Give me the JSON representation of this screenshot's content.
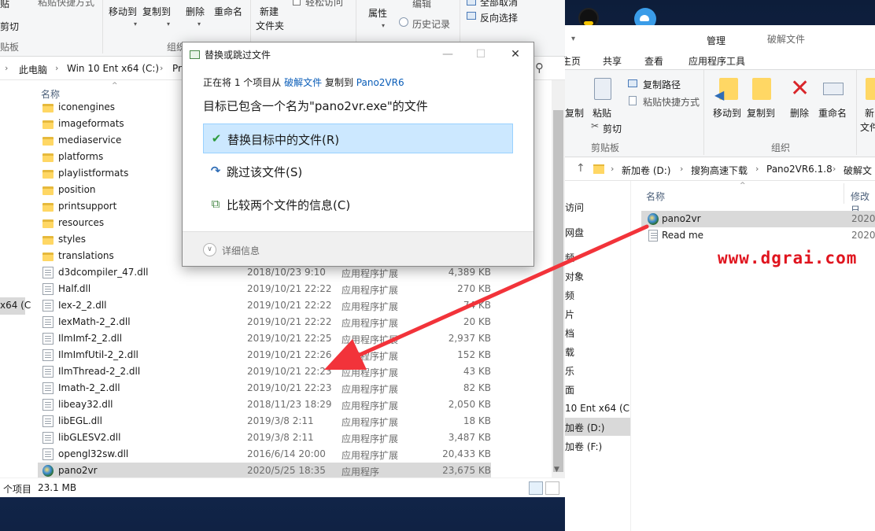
{
  "left_window": {
    "ribbon": {
      "clipboard_partial": "贴",
      "paste_shortcut_partial": "粘贴快捷方式",
      "cut": "剪切",
      "clipboard_group": "贴板",
      "move_to": "移动到",
      "copy_to": "复制到",
      "delete": "删除",
      "rename": "重命名",
      "new_folder_line1": "新建",
      "new_folder_line2": "文件夹",
      "easy_access_partial": "轻松访问",
      "organize_group": "组织",
      "new_group_partial": "新",
      "properties": "属性",
      "edit_partial": "编辑",
      "history": "历史记录",
      "select_none_partial": "全部取消",
      "invert_selection": "反向选择"
    },
    "address": {
      "parts": [
        "此电脑",
        "Win 10 Ent x64 (C:)",
        "Pr"
      ]
    },
    "column_name": "名称",
    "nav_selected_partial": "x64 (C",
    "files": [
      {
        "name": "iconengines",
        "date": "",
        "type": "",
        "size": "",
        "kind": "folder"
      },
      {
        "name": "imageformats",
        "date": "",
        "type": "",
        "size": "",
        "kind": "folder"
      },
      {
        "name": "mediaservice",
        "date": "",
        "type": "",
        "size": "",
        "kind": "folder"
      },
      {
        "name": "platforms",
        "date": "",
        "type": "",
        "size": "",
        "kind": "folder"
      },
      {
        "name": "playlistformats",
        "date": "",
        "type": "",
        "size": "",
        "kind": "folder"
      },
      {
        "name": "position",
        "date": "",
        "type": "",
        "size": "",
        "kind": "folder"
      },
      {
        "name": "printsupport",
        "date": "",
        "type": "",
        "size": "",
        "kind": "folder"
      },
      {
        "name": "resources",
        "date": "",
        "type": "",
        "size": "",
        "kind": "folder"
      },
      {
        "name": "styles",
        "date": "",
        "type": "",
        "size": "",
        "kind": "folder"
      },
      {
        "name": "translations",
        "date": "",
        "type": "",
        "size": "",
        "kind": "folder"
      },
      {
        "name": "d3dcompiler_47.dll",
        "date": "2018/10/23 9:10",
        "type": "应用程序扩展",
        "size": "4,389 KB",
        "kind": "dll"
      },
      {
        "name": "Half.dll",
        "date": "2019/10/21 22:22",
        "type": "应用程序扩展",
        "size": "270 KB",
        "kind": "dll"
      },
      {
        "name": "Iex-2_2.dll",
        "date": "2019/10/21 22:22",
        "type": "应用程序扩展",
        "size": "74 KB",
        "kind": "dll"
      },
      {
        "name": "IexMath-2_2.dll",
        "date": "2019/10/21 22:22",
        "type": "应用程序扩展",
        "size": "20 KB",
        "kind": "dll"
      },
      {
        "name": "IlmImf-2_2.dll",
        "date": "2019/10/21 22:25",
        "type": "应用程序扩展",
        "size": "2,937 KB",
        "kind": "dll"
      },
      {
        "name": "IlmImfUtil-2_2.dll",
        "date": "2019/10/21 22:26",
        "type": "应用程序扩展",
        "size": "152 KB",
        "kind": "dll"
      },
      {
        "name": "IlmThread-2_2.dll",
        "date": "2019/10/21 22:23",
        "type": "应用程序扩展",
        "size": "43 KB",
        "kind": "dll"
      },
      {
        "name": "Imath-2_2.dll",
        "date": "2019/10/21 22:23",
        "type": "应用程序扩展",
        "size": "82 KB",
        "kind": "dll"
      },
      {
        "name": "libeay32.dll",
        "date": "2018/11/23 18:29",
        "type": "应用程序扩展",
        "size": "2,050 KB",
        "kind": "dll"
      },
      {
        "name": "libEGL.dll",
        "date": "2019/3/8 2:11",
        "type": "应用程序扩展",
        "size": "18 KB",
        "kind": "dll"
      },
      {
        "name": "libGLESV2.dll",
        "date": "2019/3/8 2:11",
        "type": "应用程序扩展",
        "size": "3,487 KB",
        "kind": "dll"
      },
      {
        "name": "opengl32sw.dll",
        "date": "2016/6/14 20:00",
        "type": "应用程序扩展",
        "size": "20,433 KB",
        "kind": "dll"
      },
      {
        "name": "pano2vr",
        "date": "2020/5/25 18:35",
        "type": "应用程序",
        "size": "23,675 KB",
        "kind": "exe",
        "selected": true
      }
    ],
    "status": {
      "count": "个项目",
      "size": "23.1 MB"
    }
  },
  "right_window": {
    "title_manage": "管理",
    "title_folder": "破解文件",
    "tabs": [
      "主页",
      "共享",
      "查看",
      "应用程序工具"
    ],
    "tab_home_partial": "主页",
    "ribbon": {
      "copy_path": "复制路径",
      "paste_shortcut": "粘贴快捷方式",
      "paste": "粘贴",
      "copy_partial": "复制",
      "cut": "剪切",
      "clipboard": "剪贴板",
      "move_to": "移动到",
      "copy_to": "复制到",
      "delete": "删除",
      "rename": "重命名",
      "new_partial": "新",
      "new_folder_partial": "文件",
      "organize": "组织"
    },
    "address": {
      "parts": [
        "新加卷 (D:)",
        "搜狗高速下载",
        "Pano2VR6.1.8",
        "破解文"
      ]
    },
    "columns": {
      "name": "名称",
      "modified": "修改日"
    },
    "nav": [
      "访问",
      "网盘",
      "频",
      "对象",
      "频",
      "片",
      "档",
      "载",
      "乐",
      "面",
      "10 Ent x64 (C",
      "加卷 (D:)",
      "加卷 (F:)"
    ],
    "files": [
      {
        "name": "pano2vr",
        "date": "2020/",
        "kind": "exe",
        "selected": true
      },
      {
        "name": "Read me",
        "date": "2020/",
        "kind": "txt"
      }
    ]
  },
  "watermark": "www.dgrai.com",
  "dialog": {
    "title": "替换或跳过文件",
    "line1_prefix": "正在将 1 个项目从",
    "line1_src": "破解文件",
    "line1_mid": "复制到",
    "line1_dst": "Pano2VR6",
    "heading": "目标已包含一个名为\"pano2vr.exe\"的文件",
    "options": [
      {
        "label": "替换目标中的文件(R)",
        "icon": "✔"
      },
      {
        "label": "跳过该文件(S)",
        "icon": "↷"
      },
      {
        "label": "比较两个文件的信息(C)",
        "icon": "⧉"
      }
    ],
    "details": "详细信息",
    "minimize_glyph": "—",
    "maximize_glyph": "☐",
    "close_glyph": "✕"
  },
  "colors": {
    "arrow": "#f2333a",
    "watermark": "#e0141e",
    "selection_blue": "#cce8ff",
    "link": "#0a5db8"
  }
}
